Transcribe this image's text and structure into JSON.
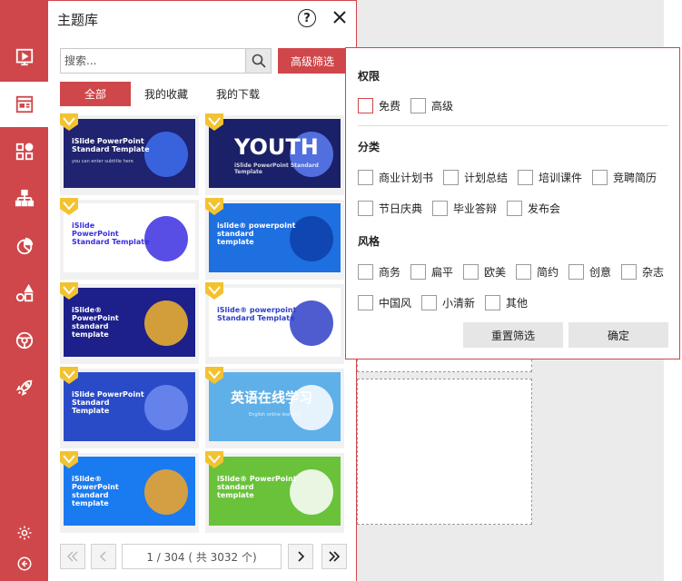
{
  "panel": {
    "title": "主题库",
    "help": "?",
    "search": {
      "placeholder": "搜索..."
    },
    "advanced_filter_label": "高级筛选",
    "tabs": [
      {
        "label": "全部",
        "active": true
      },
      {
        "label": "我的收藏",
        "active": false
      },
      {
        "label": "我的下载",
        "active": false
      }
    ],
    "templates": [
      {
        "title": "iSlide PowerPoint\nStandard Template",
        "subtitle": "you can enter subtitle here",
        "bg": "#1f2370",
        "accent": "#3d6ff0"
      },
      {
        "title": "YOUTH",
        "subtitle": "iSlide PowerPoint Standard Template",
        "bg": "#1b2168",
        "accent": "#5b7cf5"
      },
      {
        "title": "iSlide\nPowerPoint\nStandard Template",
        "subtitle": "",
        "bg": "#ffffff",
        "accent": "#3b2ee0"
      },
      {
        "title": "islide® powerpoint\nstandard\ntemplate",
        "subtitle": "",
        "bg": "#1e6fe0",
        "accent": "#0e3fa8"
      },
      {
        "title": "iSlide®\nPowerPoint\nstandard\ntemplate",
        "subtitle": "",
        "bg": "#1d1f8a",
        "accent": "#f2b52c"
      },
      {
        "title": "iSlide® powerpoint\nStandard Template",
        "subtitle": "",
        "bg": "#ffffff",
        "accent": "#2f3fc8"
      },
      {
        "title": "iSlide PowerPoint\nStandard\nTemplate",
        "subtitle": "",
        "bg": "#2a4bc8",
        "accent": "#6f8cf0"
      },
      {
        "title": "英语在线学习",
        "subtitle": "English online learning",
        "bg": "#5fb0e8",
        "accent": "#ffffff"
      },
      {
        "title": "iSlide®\nPowerPoint\nstandard\ntemplate",
        "subtitle": "",
        "bg": "#1a7af0",
        "accent": "#f6a623"
      },
      {
        "title": "iSlide® PowerPoint\nstandard\ntemplate",
        "subtitle": "",
        "bg": "#6ac23a",
        "accent": "#ffffff"
      }
    ],
    "pager": {
      "info": "1 / 304 ( 共 3032 个)"
    }
  },
  "filter": {
    "sections": [
      {
        "title": "权限",
        "options": [
          "免费",
          "高级"
        ]
      },
      {
        "title": "分类",
        "options": [
          "商业计划书",
          "计划总结",
          "培训课件",
          "竞聘简历",
          "节日庆典",
          "毕业答辩",
          "发布会"
        ]
      },
      {
        "title": "风格",
        "options": [
          "商务",
          "扁平",
          "欧美",
          "简约",
          "创意",
          "杂志",
          "中国风",
          "小清新",
          "其他"
        ]
      }
    ],
    "reset_label": "重置筛选",
    "confirm_label": "确定"
  },
  "colors": {
    "brand": "#cf474a",
    "badge": "#f2c230"
  },
  "rail_icons": [
    "slideshow-icon",
    "theme-library-icon",
    "shapes-icon",
    "diagram-icon",
    "chart-icon",
    "icons-library-icon",
    "photos-icon",
    "rocket-icon",
    "settings-icon",
    "collapse-icon"
  ]
}
